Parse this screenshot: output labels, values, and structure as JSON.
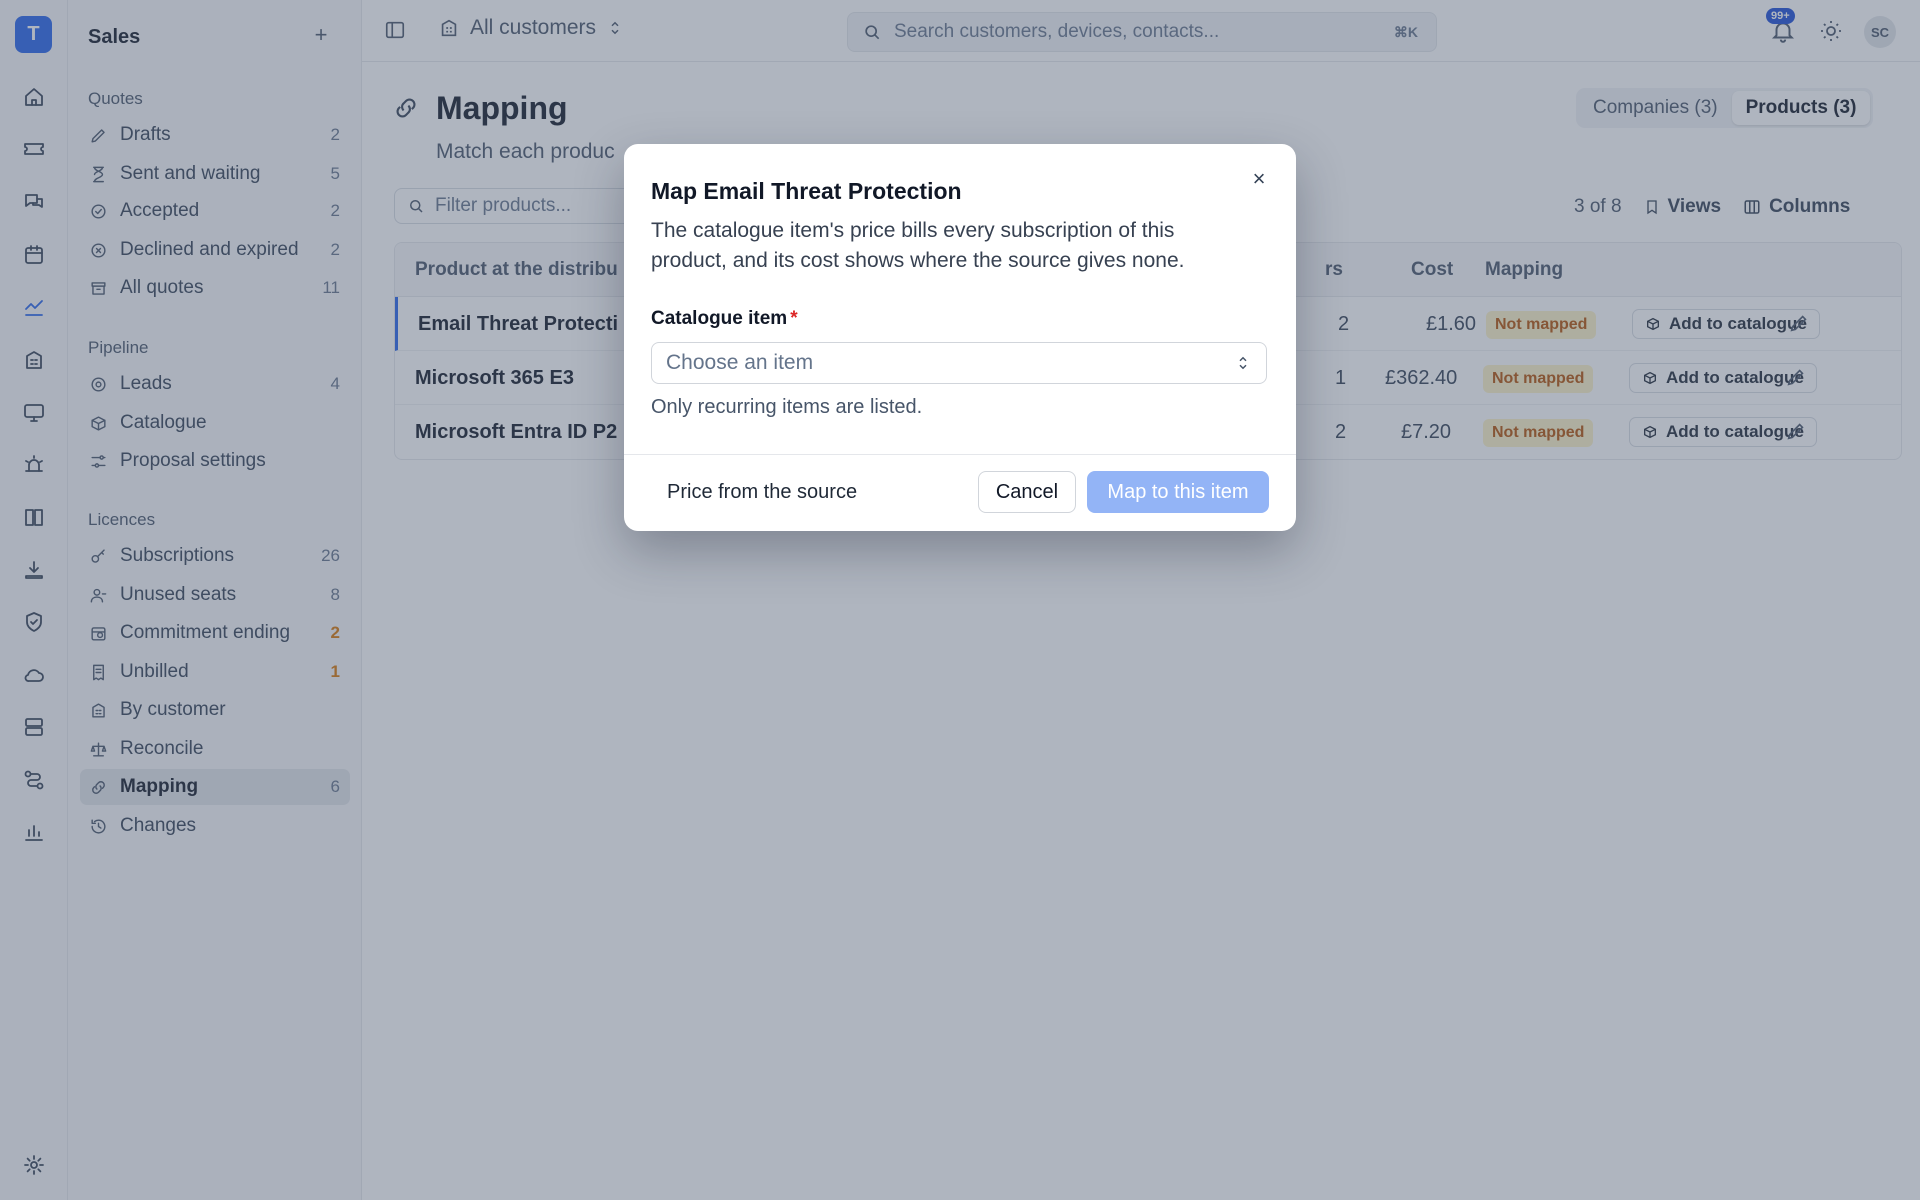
{
  "rail": {
    "logo": "T"
  },
  "sidebar": {
    "title": "Sales",
    "add_label": "+",
    "groups": [
      {
        "label": "Quotes"
      },
      {
        "label": "Pipeline"
      },
      {
        "label": "Licences"
      }
    ],
    "items": [
      {
        "label": "Drafts",
        "count": "2"
      },
      {
        "label": "Sent and waiting",
        "count": "5"
      },
      {
        "label": "Accepted",
        "count": "2"
      },
      {
        "label": "Declined and expired",
        "count": "2"
      },
      {
        "label": "All quotes",
        "count": "11"
      },
      {
        "label": "Leads",
        "count": "4"
      },
      {
        "label": "Catalogue",
        "count": ""
      },
      {
        "label": "Proposal settings",
        "count": ""
      },
      {
        "label": "Subscriptions",
        "count": "26"
      },
      {
        "label": "Unused seats",
        "count": "8"
      },
      {
        "label": "Commitment ending",
        "count": "2"
      },
      {
        "label": "Unbilled",
        "count": "1"
      },
      {
        "label": "By customer",
        "count": ""
      },
      {
        "label": "Reconcile",
        "count": ""
      },
      {
        "label": "Mapping",
        "count": "6"
      },
      {
        "label": "Changes",
        "count": ""
      }
    ]
  },
  "topbar": {
    "scope": "All customers",
    "search_placeholder": "Search customers, devices, contacts...",
    "search_shortcut": "⌘K",
    "notif_badge": "99+",
    "avatar_initials": "SC"
  },
  "main": {
    "title": "Mapping",
    "subtitle": "Match each produc",
    "tabs": [
      {
        "label": "Companies (3)"
      },
      {
        "label": "Products (3)"
      }
    ],
    "filter_placeholder": "Filter products...",
    "row_count": "3 of 8",
    "views_label": "Views",
    "columns_label": "Columns",
    "table": {
      "headers": {
        "product": "Product at the distribu",
        "subs": "rs",
        "cost": "Cost",
        "mapping": "Mapping"
      },
      "rows": [
        {
          "product": "Email Threat Protecti",
          "subs": "2",
          "cost": "£1.60",
          "status": "Not mapped",
          "action": "Add to catalogue"
        },
        {
          "product": "Microsoft 365 E3",
          "subs": "1",
          "cost": "£362.40",
          "status": "Not mapped",
          "action": "Add to catalogue"
        },
        {
          "product": "Microsoft Entra ID P2",
          "subs": "2",
          "cost": "£7.20",
          "status": "Not mapped",
          "action": "Add to catalogue"
        }
      ]
    }
  },
  "modal": {
    "title": "Map Email Threat Protection",
    "description": "The catalogue item's price bills every subscription of this product, and its cost shows where the source gives none.",
    "field_label": "Catalogue item",
    "required_mark": "*",
    "select_placeholder": "Choose an item",
    "hint": "Only recurring items are listed.",
    "secondary_action": "Price from the source",
    "cancel_label": "Cancel",
    "submit_label": "Map to this item",
    "close_label": "×"
  },
  "colors": {
    "accent": "#2563eb",
    "warning": "#d97706",
    "badge_bg": "#fef3c7"
  }
}
